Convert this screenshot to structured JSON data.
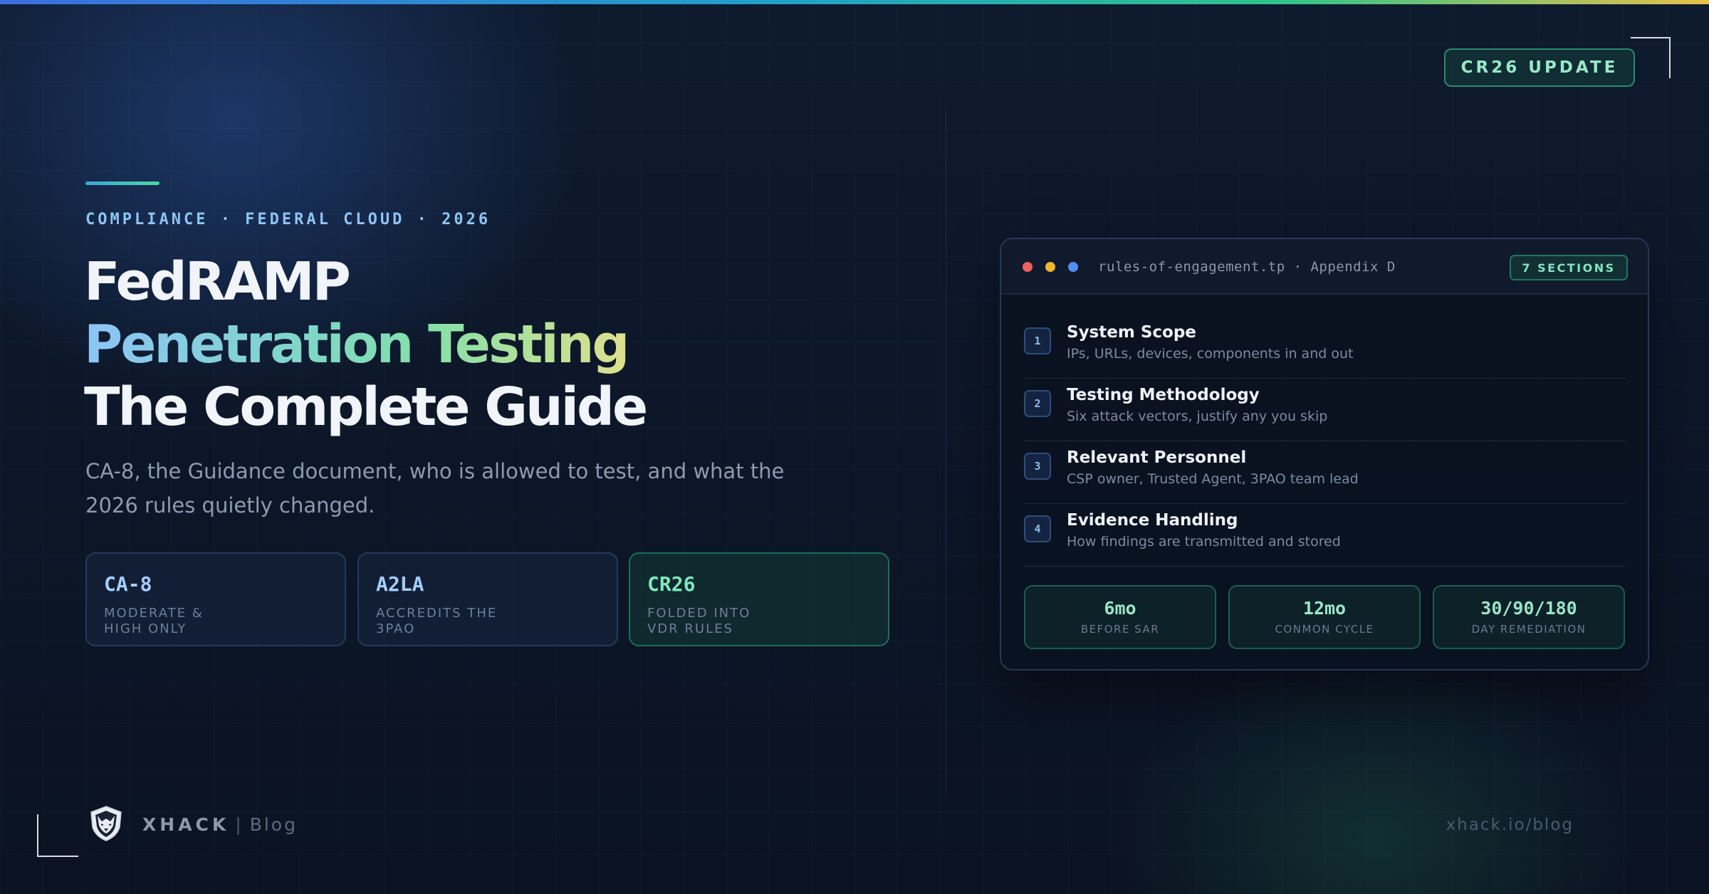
{
  "update_badge": "CR26 UPDATE",
  "eyebrow": "COMPLIANCE · FEDERAL CLOUD · 2026",
  "title": {
    "line1": "FedRAMP",
    "line2": "Penetration Testing",
    "line3": "The Complete Guide"
  },
  "subtitle": "CA-8, the Guidance document, who is allowed to test, and what the 2026 rules quietly changed.",
  "stats": [
    {
      "title": "CA-8",
      "sub": "MODERATE & HIGH ONLY"
    },
    {
      "title": "A2LA",
      "sub": "ACCREDITS THE 3PAO"
    },
    {
      "title": "CR26",
      "sub": "FOLDED INTO VDR RULES"
    }
  ],
  "terminal": {
    "filename": "rules-of-engagement.tp · Appendix D",
    "sections_badge": "7 SECTIONS",
    "items": [
      {
        "num": "1",
        "title": "System Scope",
        "desc": "IPs, URLs, devices, components in and out"
      },
      {
        "num": "2",
        "title": "Testing Methodology",
        "desc": "Six attack vectors, justify any you skip"
      },
      {
        "num": "3",
        "title": "Relevant Personnel",
        "desc": "CSP owner, Trusted Agent, 3PAO team lead"
      },
      {
        "num": "4",
        "title": "Evidence Handling",
        "desc": "How findings are transmitted and stored"
      }
    ],
    "metrics": [
      {
        "value": "6mo",
        "label": "BEFORE SAR"
      },
      {
        "value": "12mo",
        "label": "CONMON CYCLE"
      },
      {
        "value": "30/90/180",
        "label": "DAY REMEDIATION"
      }
    ]
  },
  "footer": {
    "brand": "XHACK",
    "separator": "|",
    "blog": "Blog",
    "url": "xhack.io/blog"
  },
  "icons": {
    "logo": "wolf-shield-icon"
  },
  "colors": {
    "background": "#0c1424",
    "accent_blue": "#8cc4f8",
    "accent_green": "#86e0a8",
    "accent_yellow": "#e6e08a"
  }
}
